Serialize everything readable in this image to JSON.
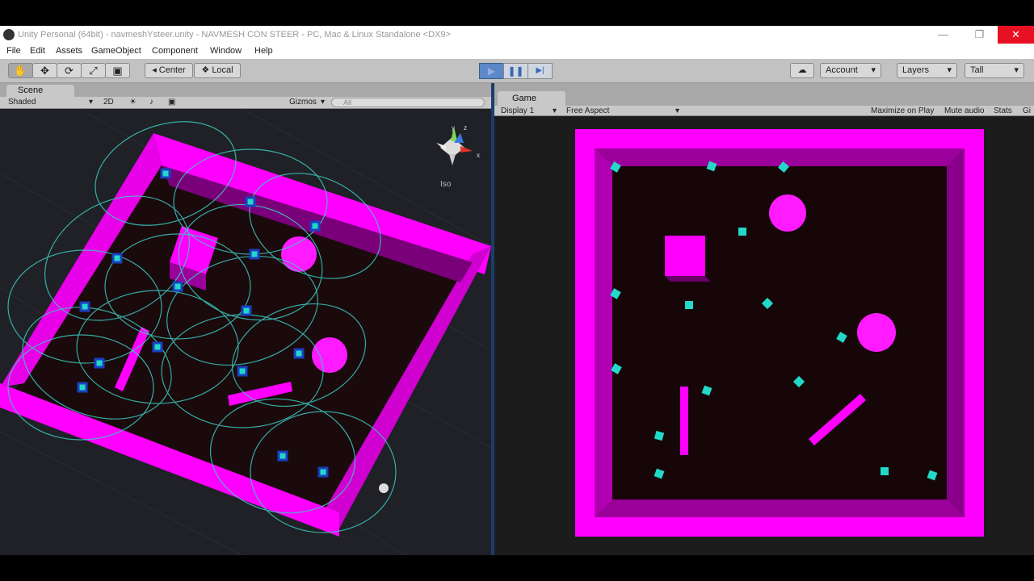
{
  "window": {
    "title": "Unity Personal (64bit) - navmeshYsteer.unity - NAVMESH CON STEER - PC, Mac & Linux Standalone <DX9>",
    "minimize": "—",
    "maximize": "❐",
    "close": "✕"
  },
  "menu": [
    "File",
    "Edit",
    "Assets",
    "GameObject",
    "Component",
    "Window",
    "Help"
  ],
  "toolbar": {
    "tools": [
      "✋",
      "✥",
      "⟳",
      "⤢",
      "▣"
    ],
    "pivot": "Center",
    "space": "Local",
    "play": "▶",
    "pause": "❚❚",
    "step": "▶|",
    "cloud": "☁",
    "account": "Account",
    "layers": "Layers",
    "layout": "Tall"
  },
  "scene": {
    "tab": "Scene",
    "shading": "Shaded",
    "mode_2d": "2D",
    "gizmos": "Gizmos",
    "search_placeholder": "All",
    "gizmo_label": "Iso",
    "axis_y": "y",
    "axis_x": "x",
    "axis_z": "z"
  },
  "game": {
    "tab": "Game",
    "display": "Display 1",
    "aspect": "Free Aspect",
    "maximize_on_play": "Maximize on Play",
    "mute_audio": "Mute audio",
    "stats": "Stats",
    "gizmos": "Gi"
  },
  "colors": {
    "wall": "#ff00ff",
    "agent": "#22d8c8",
    "floor": "#160608"
  }
}
